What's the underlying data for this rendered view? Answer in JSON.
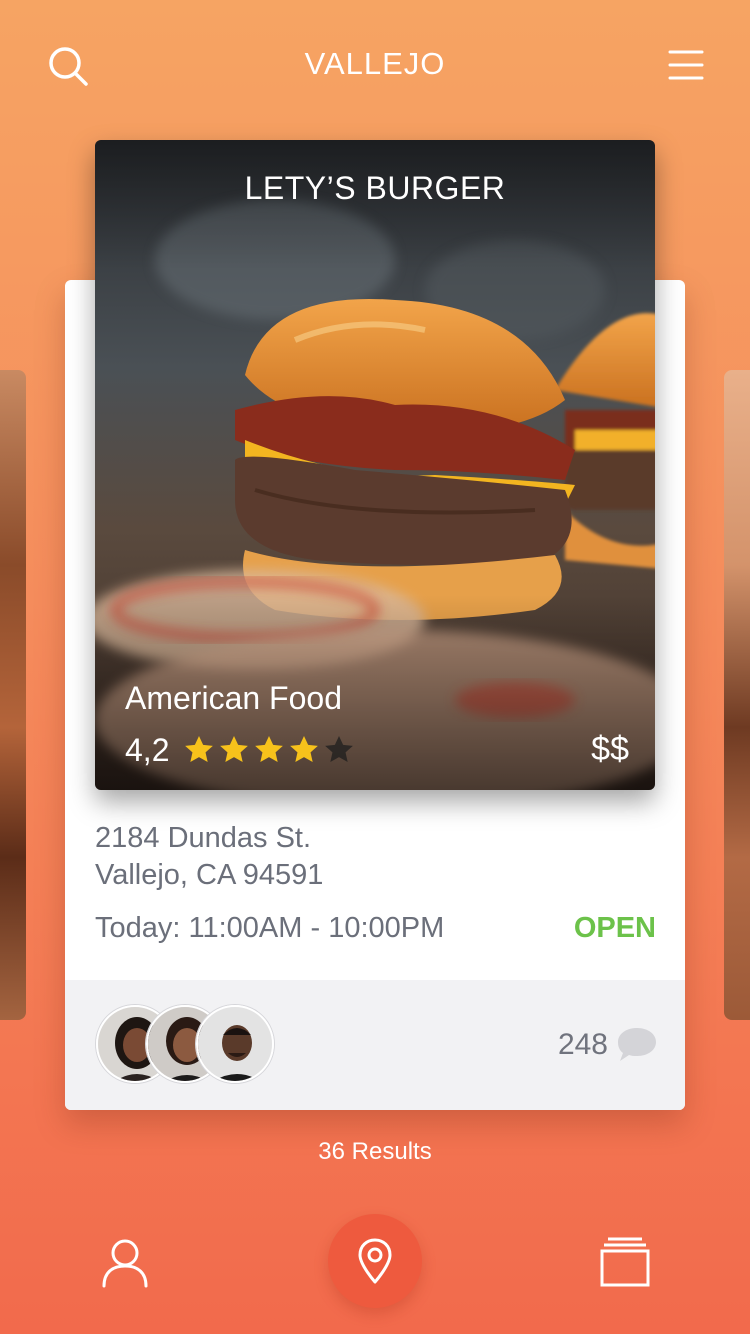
{
  "header": {
    "city": "VALLEJO",
    "search_icon": "search-icon",
    "menu_icon": "hamburger-menu-icon"
  },
  "restaurant": {
    "name": "LETY’S BURGER",
    "cuisine": "American Food",
    "rating": "4,2",
    "rating_value": 4.2,
    "stars_filled": 4,
    "stars_total": 5,
    "price": "$$",
    "address_line1": "2184 Dundas St.",
    "address_line2": "Vallejo, CA 94591",
    "hours": "Today: 11:00AM - 10:00PM",
    "status": "OPEN",
    "review_count": "248"
  },
  "results": "36 Results",
  "nav": {
    "profile_icon": "user-icon",
    "map_icon": "map-pin-icon",
    "cards_icon": "cards-stack-icon"
  },
  "colors": {
    "accent": "#ee5a3e",
    "open_status": "#6cc24a",
    "star": "#f7c21b",
    "text_muted": "#6b6f7a"
  }
}
